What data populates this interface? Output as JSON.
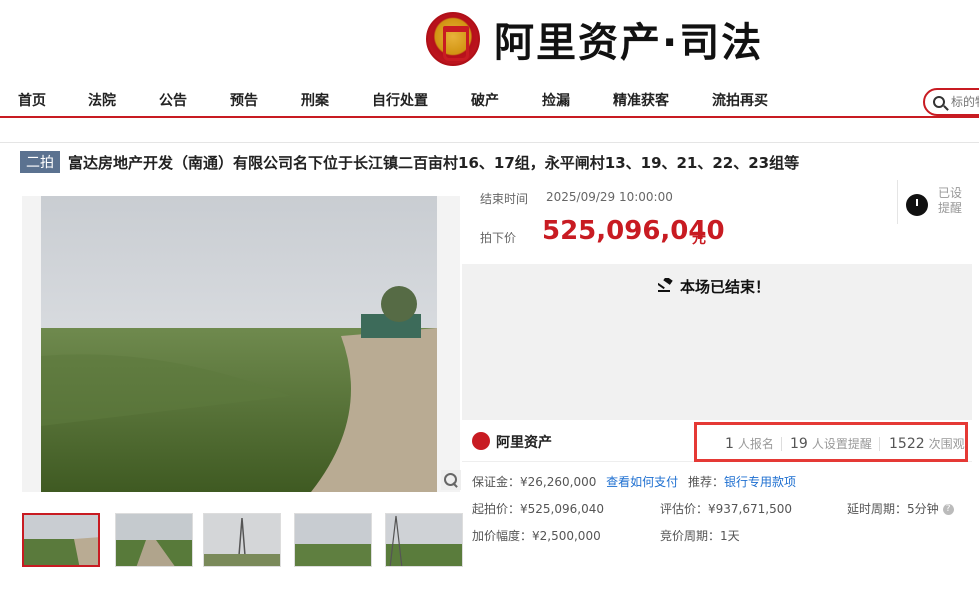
{
  "header": {
    "logo_text": "阿里资产·司法"
  },
  "nav": {
    "items": [
      "首页",
      "法院",
      "公告",
      "预告",
      "刑案",
      "自行处置",
      "破产",
      "捡漏",
      "精准获客",
      "流拍再买"
    ],
    "search_placeholder": "标的物"
  },
  "auction": {
    "badge": "二拍",
    "title": "富达房地产开发（南通）有限公司名下位于长江镇二百亩村16、17组，永平闸村13、19、21、22、23组等",
    "end_time_label": "结束时间",
    "end_time_value": "2025/09/29 10:00:00",
    "price_label": "拍下价",
    "price_value": "525,096,040",
    "price_unit": "元",
    "reminder_text": "已设提醒",
    "ended_text": "本场已结束！"
  },
  "platform": {
    "name": "阿里资产",
    "stats": [
      {
        "num": "1",
        "label": "人报名"
      },
      {
        "num": "19",
        "label": "人设置提醒"
      },
      {
        "num": "1522",
        "label": "次围观"
      }
    ]
  },
  "details": {
    "deposit": "保证金：¥26,260,000",
    "deposit_link": "查看如何支付",
    "recommend_label": "推荐：",
    "recommend_link": "银行专用款项",
    "start_price": "起拍价：¥525,096,040",
    "eval_price": "评估价：¥937,671,500",
    "delay": "延时周期：5分钟",
    "increment": "加价幅度：¥2,500,000",
    "cycle": "竞价周期：1天"
  },
  "colors": {
    "brand_red": "#c81b22",
    "highlight": "#e53935",
    "badge_bg": "#5b7290"
  }
}
